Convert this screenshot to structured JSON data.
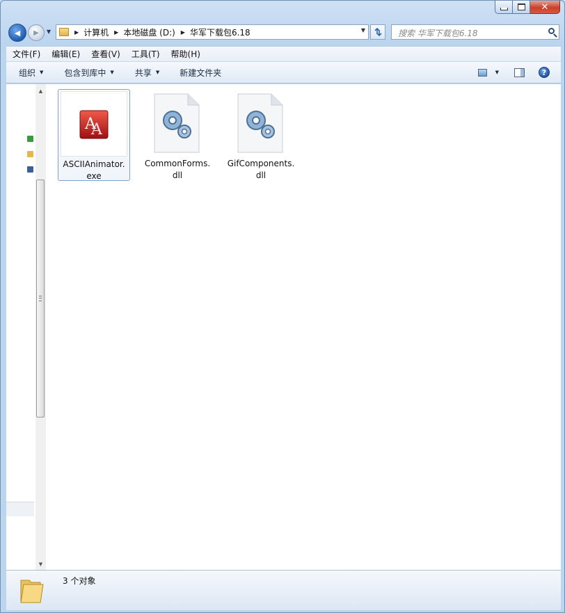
{
  "window": {
    "minimize_glyph": "",
    "close_glyph": "✕"
  },
  "navigation": {
    "back_glyph": "◀",
    "forward_glyph": "▶",
    "breadcrumbs": [
      "计算机",
      "本地磁盘 (D:)",
      "华军下载包6.18"
    ],
    "crumb_separator": "▶",
    "search_placeholder": "搜索 华军下载包6.18"
  },
  "menubar": {
    "items": [
      "文件(F)",
      "编辑(E)",
      "查看(V)",
      "工具(T)",
      "帮助(H)"
    ]
  },
  "toolbar": {
    "organize_label": "组织",
    "include_label": "包含到库中",
    "share_label": "共享",
    "new_folder_label": "新建文件夹",
    "dropdown_glyph": "▼",
    "help_glyph": "?"
  },
  "files": [
    {
      "line1": "ASCIIAnimator.",
      "line2": "exe",
      "icon": "ascii-animator-app-icon",
      "selected": true
    },
    {
      "line1": "CommonForms.",
      "line2": "dll",
      "icon": "dll-gears-icon",
      "selected": false
    },
    {
      "line1": "GifComponents.",
      "line2": "dll",
      "icon": "dll-gears-icon",
      "selected": false
    }
  ],
  "status": {
    "item_count": "3 个对象"
  },
  "colors": {
    "accent_blue": "#1f5db4",
    "selection_border": "#7da2ce",
    "close_red": "#c8412b",
    "folder_yellow": "#e1b44a"
  }
}
